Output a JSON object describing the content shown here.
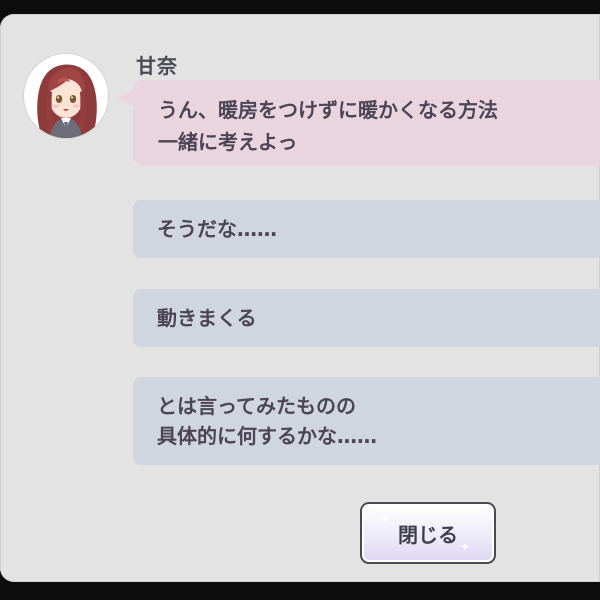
{
  "dialog": {
    "speaker_name": "甘奈",
    "message": "うん、暖房をつけずに暖かくなる方法\n一緒に考えよっ"
  },
  "choices": [
    {
      "text": "そうだな……"
    },
    {
      "text": "動きまくる"
    },
    {
      "text": "とは言ってみたものの\n具体的に何するかな……"
    }
  ],
  "close_button": {
    "label": "閉じる"
  },
  "colors": {
    "panel_bg": "#e3e3e3",
    "speech_bubble": "#ead4de",
    "choice_bg": "#cfd6df",
    "text": "#4b4555",
    "button_border": "#4a4a55"
  },
  "avatar": {
    "icon": "character-portrait-icon"
  }
}
